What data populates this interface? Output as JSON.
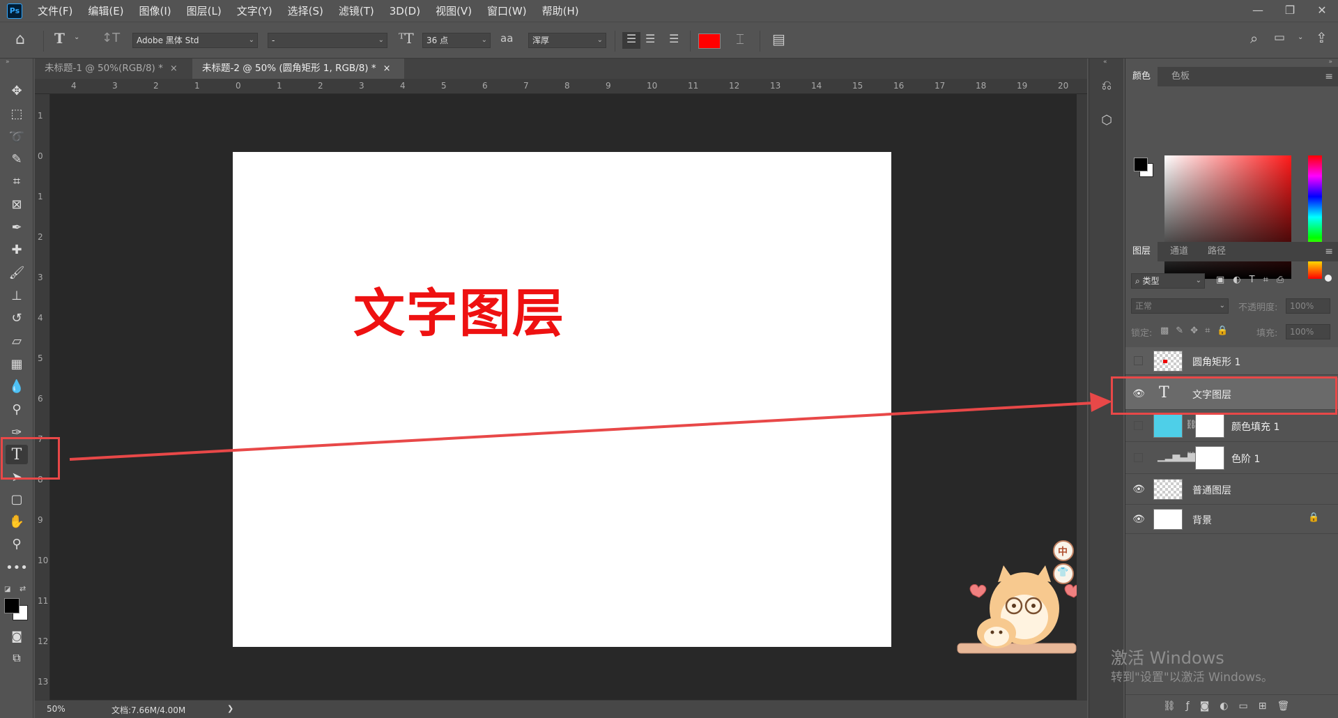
{
  "app": {
    "logo": "Ps"
  },
  "menu": [
    "文件(F)",
    "编辑(E)",
    "图像(I)",
    "图层(L)",
    "文字(Y)",
    "选择(S)",
    "滤镜(T)",
    "3D(D)",
    "视图(V)",
    "窗口(W)",
    "帮助(H)"
  ],
  "window_controls": {
    "minimize": "—",
    "restore": "❐",
    "close": "✕"
  },
  "options": {
    "font_family": "Adobe 黑体 Std",
    "font_style": "-",
    "font_size": "36 点",
    "antialias_label": "aa",
    "antialias": "浑厚",
    "text_color": "#ff0000"
  },
  "tabs": [
    {
      "title": "未标题-1 @ 50%(RGB/8) *",
      "close": "×"
    },
    {
      "title": "未标题-2 @ 50% (圆角矩形 1, RGB/8) *",
      "close": "×"
    }
  ],
  "ruler_top": [
    "4",
    "3",
    "2",
    "1",
    "0",
    "1",
    "2",
    "3",
    "4",
    "5",
    "6",
    "7",
    "8",
    "9",
    "10",
    "11",
    "12",
    "13",
    "14",
    "15",
    "16",
    "17",
    "18",
    "19",
    "20"
  ],
  "ruler_left": [
    "1",
    "0",
    "1",
    "2",
    "3",
    "4",
    "5",
    "6",
    "7",
    "8",
    "9",
    "10",
    "11",
    "12",
    "13"
  ],
  "canvas": {
    "text": "文字图层",
    "text_color": "#ee1111"
  },
  "status": {
    "zoom": "50%",
    "doc": "文档:7.66M/4.00M",
    "arrow": "❯"
  },
  "color_panel": {
    "tabs": [
      "颜色",
      "色板"
    ],
    "foreground": "#000000",
    "background": "#ffffff"
  },
  "layers_panel": {
    "tabs": [
      "图层",
      "通道",
      "路径"
    ],
    "filter": "类型",
    "blend_mode": "正常",
    "opacity_label": "不透明度:",
    "opacity": "100%",
    "lock_label": "锁定:",
    "fill_label": "填充:",
    "fill": "100%",
    "layers": [
      {
        "name": "圆角矩形 1",
        "visible": false
      },
      {
        "name": "文字图层",
        "visible": true,
        "selected": true,
        "type_icon": "T"
      },
      {
        "name": "颜色填充 1",
        "visible": false
      },
      {
        "name": "色阶 1",
        "visible": false
      },
      {
        "name": "普通图层",
        "visible": true
      },
      {
        "name": "背景",
        "visible": true
      }
    ]
  },
  "watermark": {
    "line1": "激活 Windows",
    "line2": "转到\"设置\"以激活 Windows。"
  },
  "sticker": {
    "badge1": "中",
    "badge2": "👕"
  }
}
